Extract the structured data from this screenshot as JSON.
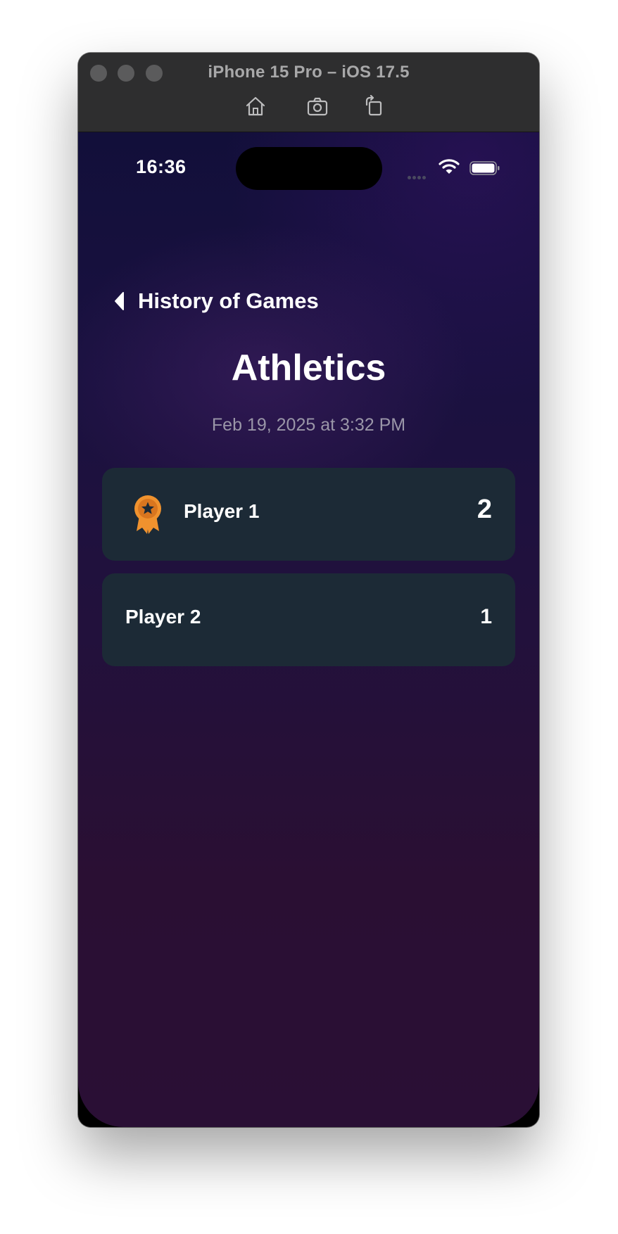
{
  "window": {
    "title": "iPhone 15 Pro – iOS 17.5",
    "toolbar": [
      "home-icon",
      "screenshot-icon",
      "rotate-icon"
    ]
  },
  "status_bar": {
    "time": "16:36",
    "icons": [
      "signal-dots-icon",
      "wifi-icon",
      "battery-icon"
    ]
  },
  "nav": {
    "back_label": "History of Games"
  },
  "game": {
    "title": "Athletics",
    "date": "Feb 19, 2025 at 3:32 PM"
  },
  "results": [
    {
      "name": "Player 1",
      "score": "2",
      "winner": true,
      "badge_icon": "medal-icon"
    },
    {
      "name": "Player 2",
      "score": "1",
      "winner": false
    }
  ],
  "colors": {
    "accent_medal": "#f0922e",
    "row_background": "#1c2a36",
    "date_text": "#9a96a8"
  }
}
